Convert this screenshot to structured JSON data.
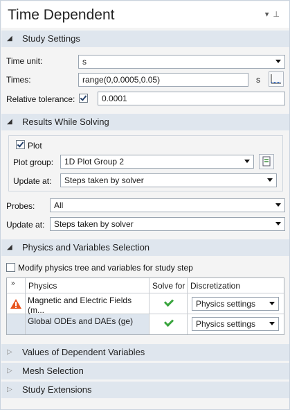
{
  "title": "Time Dependent",
  "study_settings": {
    "header": "Study Settings",
    "time_unit_label": "Time unit:",
    "time_unit_value": "s",
    "times_label": "Times:",
    "times_value": "range(0,0.0005,0.05)",
    "times_unit": "s",
    "rel_tol_label": "Relative tolerance:",
    "rel_tol_checked": true,
    "rel_tol_value": "0.0001"
  },
  "results_while_solving": {
    "header": "Results While Solving",
    "plot_label": "Plot",
    "plot_checked": true,
    "plot_group_label": "Plot group:",
    "plot_group_value": "1D Plot Group 2",
    "update_at_label": "Update at:",
    "update_at_value": "Steps taken by solver",
    "probes_label": "Probes:",
    "probes_value": "All",
    "update_at2_label": "Update at:",
    "update_at2_value": "Steps taken by solver"
  },
  "physics_selection": {
    "header": "Physics and Variables Selection",
    "modify_label": "Modify physics tree and variables for study step",
    "modify_checked": false,
    "columns": [
      "Physics",
      "Solve for",
      "Discretization"
    ],
    "rows": [
      {
        "physics": "Magnetic and Electric Fields (m...",
        "solve_for": true,
        "discretization": "Physics settings",
        "warning": true
      },
      {
        "physics": "Global ODEs and DAEs (ge)",
        "solve_for": true,
        "discretization": "Physics settings",
        "warning": false
      }
    ]
  },
  "collapsed_sections": [
    "Values of Dependent Variables",
    "Mesh Selection",
    "Study Extensions"
  ],
  "colors": {
    "section_bg": "#dfe6ee",
    "warning": "#e8541e",
    "check_green": "#3aa53f"
  }
}
